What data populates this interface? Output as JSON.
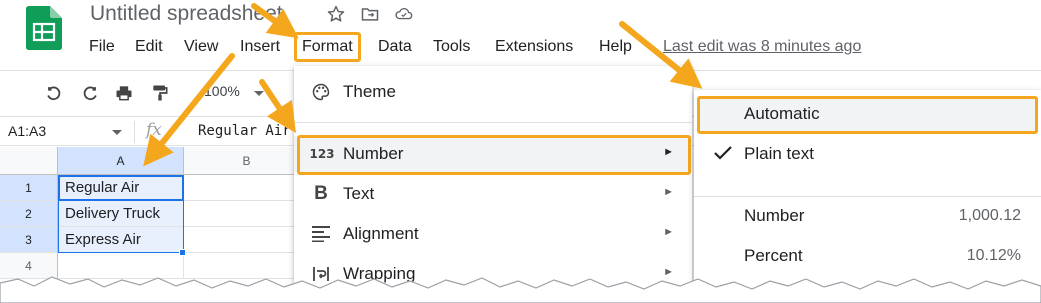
{
  "app": {
    "title": "Untitled spreadsheet",
    "icons": [
      "star-icon",
      "move-to-folder-icon",
      "cloud-status-icon"
    ],
    "last_edit": "Last edit was 8 minutes ago"
  },
  "menubar": {
    "items": [
      "File",
      "Edit",
      "View",
      "Insert",
      "Format",
      "Data",
      "Tools",
      "Extensions",
      "Help"
    ]
  },
  "toolbar": {
    "icons": [
      "undo-icon",
      "redo-icon",
      "print-icon",
      "paint-format-icon"
    ],
    "zoom": "100%"
  },
  "formula_bar": {
    "range": "A1:A3",
    "fx": "fx",
    "value": "Regular Air"
  },
  "grid": {
    "columns": [
      "A",
      "B"
    ],
    "rows": [
      "1",
      "2",
      "3",
      "4"
    ],
    "cells": [
      "Regular Air",
      "Delivery Truck",
      "Express Air",
      ""
    ]
  },
  "format_menu": {
    "items": [
      {
        "label": "Theme",
        "icon": "palette-icon",
        "submenu": false
      },
      {
        "label": "Number",
        "icon": "number-format-icon",
        "submenu": true
      },
      {
        "label": "Text",
        "icon": "bold-icon",
        "submenu": true
      },
      {
        "label": "Alignment",
        "icon": "align-icon",
        "submenu": true
      },
      {
        "label": "Wrapping",
        "icon": "wrap-icon",
        "submenu": true
      }
    ],
    "submenu_arrow": "►"
  },
  "number_menu": {
    "automatic": "Automatic",
    "plain_text": "Plain text",
    "number": {
      "label": "Number",
      "example": "1,000.12"
    },
    "percent": {
      "label": "Percent",
      "example": "10.12%"
    }
  },
  "colors": {
    "highlight": "#f4a71d",
    "selection": "#1a73e8",
    "sheets_green": "#0f9d58"
  }
}
